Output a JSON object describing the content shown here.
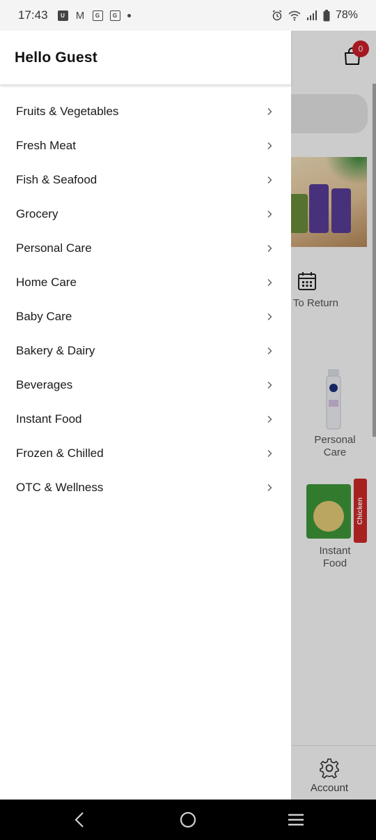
{
  "status_bar": {
    "time": "17:43",
    "notification_icons": [
      "u-app-icon",
      "gmail-icon",
      "gallery-icon",
      "gallery-icon",
      "dot-icon"
    ],
    "notif_glyphs": [
      "U",
      "M",
      "G",
      "G"
    ],
    "right_icons": [
      "alarm-icon",
      "wifi-icon",
      "signal-icon",
      "battery-icon"
    ],
    "battery": "78%"
  },
  "background_app": {
    "cart_badge": "0",
    "easy_return_label": "ys To Return",
    "categories": [
      {
        "label_line1": "Personal",
        "label_line2": "Care"
      },
      {
        "label_line1": "Instant",
        "label_line2": "Food"
      }
    ],
    "chicken_tag": "Chicken",
    "bottom_nav": {
      "account_label": "Account"
    },
    "colors": {
      "badge": "#d0202b"
    }
  },
  "drawer": {
    "title": "Hello Guest",
    "items": [
      {
        "label": "Fruits & Vegetables"
      },
      {
        "label": "Fresh Meat"
      },
      {
        "label": "Fish & Seafood"
      },
      {
        "label": "Grocery"
      },
      {
        "label": "Personal Care"
      },
      {
        "label": "Home Care"
      },
      {
        "label": "Baby Care"
      },
      {
        "label": "Bakery & Dairy"
      },
      {
        "label": "Beverages"
      },
      {
        "label": "Instant Food"
      },
      {
        "label": "Frozen & Chilled"
      },
      {
        "label": "OTC & Wellness"
      }
    ]
  },
  "nav_bar": {
    "buttons": [
      "back-icon",
      "home-icon",
      "recents-icon"
    ]
  }
}
